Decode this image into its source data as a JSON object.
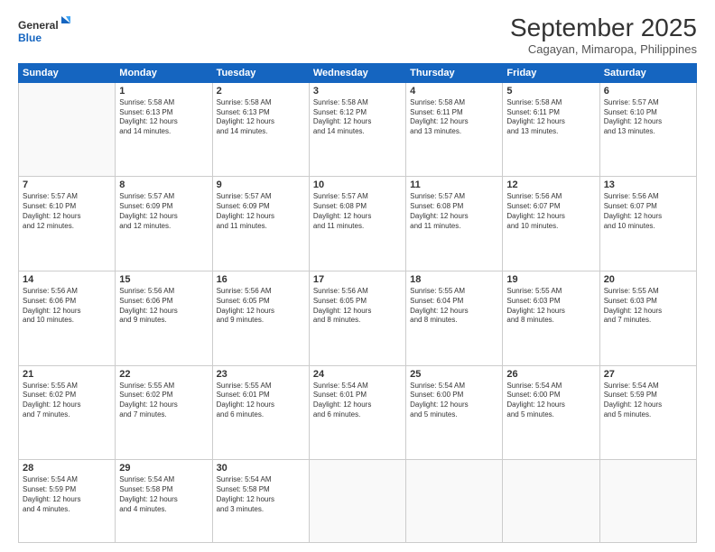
{
  "logo": {
    "line1": "General",
    "line2": "Blue"
  },
  "header": {
    "title": "September 2025",
    "subtitle": "Cagayan, Mimaropa, Philippines"
  },
  "days": [
    "Sunday",
    "Monday",
    "Tuesday",
    "Wednesday",
    "Thursday",
    "Friday",
    "Saturday"
  ],
  "weeks": [
    [
      {
        "day": "",
        "info": ""
      },
      {
        "day": "1",
        "info": "Sunrise: 5:58 AM\nSunset: 6:13 PM\nDaylight: 12 hours\nand 14 minutes."
      },
      {
        "day": "2",
        "info": "Sunrise: 5:58 AM\nSunset: 6:13 PM\nDaylight: 12 hours\nand 14 minutes."
      },
      {
        "day": "3",
        "info": "Sunrise: 5:58 AM\nSunset: 6:12 PM\nDaylight: 12 hours\nand 14 minutes."
      },
      {
        "day": "4",
        "info": "Sunrise: 5:58 AM\nSunset: 6:11 PM\nDaylight: 12 hours\nand 13 minutes."
      },
      {
        "day": "5",
        "info": "Sunrise: 5:58 AM\nSunset: 6:11 PM\nDaylight: 12 hours\nand 13 minutes."
      },
      {
        "day": "6",
        "info": "Sunrise: 5:57 AM\nSunset: 6:10 PM\nDaylight: 12 hours\nand 13 minutes."
      }
    ],
    [
      {
        "day": "7",
        "info": "Sunrise: 5:57 AM\nSunset: 6:10 PM\nDaylight: 12 hours\nand 12 minutes."
      },
      {
        "day": "8",
        "info": "Sunrise: 5:57 AM\nSunset: 6:09 PM\nDaylight: 12 hours\nand 12 minutes."
      },
      {
        "day": "9",
        "info": "Sunrise: 5:57 AM\nSunset: 6:09 PM\nDaylight: 12 hours\nand 11 minutes."
      },
      {
        "day": "10",
        "info": "Sunrise: 5:57 AM\nSunset: 6:08 PM\nDaylight: 12 hours\nand 11 minutes."
      },
      {
        "day": "11",
        "info": "Sunrise: 5:57 AM\nSunset: 6:08 PM\nDaylight: 12 hours\nand 11 minutes."
      },
      {
        "day": "12",
        "info": "Sunrise: 5:56 AM\nSunset: 6:07 PM\nDaylight: 12 hours\nand 10 minutes."
      },
      {
        "day": "13",
        "info": "Sunrise: 5:56 AM\nSunset: 6:07 PM\nDaylight: 12 hours\nand 10 minutes."
      }
    ],
    [
      {
        "day": "14",
        "info": "Sunrise: 5:56 AM\nSunset: 6:06 PM\nDaylight: 12 hours\nand 10 minutes."
      },
      {
        "day": "15",
        "info": "Sunrise: 5:56 AM\nSunset: 6:06 PM\nDaylight: 12 hours\nand 9 minutes."
      },
      {
        "day": "16",
        "info": "Sunrise: 5:56 AM\nSunset: 6:05 PM\nDaylight: 12 hours\nand 9 minutes."
      },
      {
        "day": "17",
        "info": "Sunrise: 5:56 AM\nSunset: 6:05 PM\nDaylight: 12 hours\nand 8 minutes."
      },
      {
        "day": "18",
        "info": "Sunrise: 5:55 AM\nSunset: 6:04 PM\nDaylight: 12 hours\nand 8 minutes."
      },
      {
        "day": "19",
        "info": "Sunrise: 5:55 AM\nSunset: 6:03 PM\nDaylight: 12 hours\nand 8 minutes."
      },
      {
        "day": "20",
        "info": "Sunrise: 5:55 AM\nSunset: 6:03 PM\nDaylight: 12 hours\nand 7 minutes."
      }
    ],
    [
      {
        "day": "21",
        "info": "Sunrise: 5:55 AM\nSunset: 6:02 PM\nDaylight: 12 hours\nand 7 minutes."
      },
      {
        "day": "22",
        "info": "Sunrise: 5:55 AM\nSunset: 6:02 PM\nDaylight: 12 hours\nand 7 minutes."
      },
      {
        "day": "23",
        "info": "Sunrise: 5:55 AM\nSunset: 6:01 PM\nDaylight: 12 hours\nand 6 minutes."
      },
      {
        "day": "24",
        "info": "Sunrise: 5:54 AM\nSunset: 6:01 PM\nDaylight: 12 hours\nand 6 minutes."
      },
      {
        "day": "25",
        "info": "Sunrise: 5:54 AM\nSunset: 6:00 PM\nDaylight: 12 hours\nand 5 minutes."
      },
      {
        "day": "26",
        "info": "Sunrise: 5:54 AM\nSunset: 6:00 PM\nDaylight: 12 hours\nand 5 minutes."
      },
      {
        "day": "27",
        "info": "Sunrise: 5:54 AM\nSunset: 5:59 PM\nDaylight: 12 hours\nand 5 minutes."
      }
    ],
    [
      {
        "day": "28",
        "info": "Sunrise: 5:54 AM\nSunset: 5:59 PM\nDaylight: 12 hours\nand 4 minutes."
      },
      {
        "day": "29",
        "info": "Sunrise: 5:54 AM\nSunset: 5:58 PM\nDaylight: 12 hours\nand 4 minutes."
      },
      {
        "day": "30",
        "info": "Sunrise: 5:54 AM\nSunset: 5:58 PM\nDaylight: 12 hours\nand 3 minutes."
      },
      {
        "day": "",
        "info": ""
      },
      {
        "day": "",
        "info": ""
      },
      {
        "day": "",
        "info": ""
      },
      {
        "day": "",
        "info": ""
      }
    ]
  ]
}
